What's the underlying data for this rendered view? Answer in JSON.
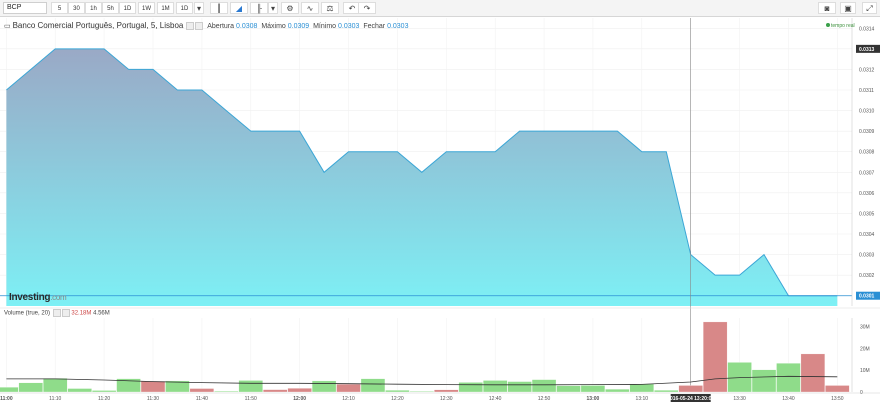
{
  "toolbar": {
    "symbol": "BCP",
    "timeframes": [
      "5",
      "30",
      "1h",
      "5h",
      "1D",
      "1W",
      "1M",
      "1D"
    ],
    "active_timeframe_index": 0,
    "tool_icons": [
      "candles-icon",
      "area-chart-icon",
      "bar-chart-icon",
      "chevron-down-icon",
      "settings-gear-icon",
      "indicators-icon",
      "compare-scale-icon",
      "undo-icon",
      "redo-icon"
    ],
    "right_icons": [
      "camera-icon",
      "layout-icon",
      "fullscreen-icon"
    ]
  },
  "legend": {
    "title": "Banco Comercial Português, Portugal, 5, Lisboa",
    "apertura_label": "Abertura",
    "apertura": "0.0308",
    "maximo_label": "Máximo",
    "maximo": "0.0309",
    "minimo_label": "Mínimo",
    "minimo": "0.0303",
    "fecho_label": "Fechar",
    "fecho": "0.0303"
  },
  "realtime_label": "tempo real",
  "watermark": {
    "brand": "Investing",
    "suffix": ".com"
  },
  "volume_legend": {
    "label": "Volume (true, 20)",
    "value_red": "32.18M",
    "value": "4.56M"
  },
  "current_price_label": "0.0313",
  "last_price_label": "0.0301",
  "crosshair_time_label": "2016-05-24 13:20:00",
  "colors": {
    "area_top": "#9aa9c6",
    "area_bottom": "#7df0f5",
    "line": "#3ba6d6",
    "bar_up": "#8fdc8a",
    "bar_down": "#d88888",
    "ma_line": "#333333",
    "last_price": "#2a8fd4"
  },
  "chart_data": [
    {
      "type": "area",
      "x_ticks": [
        "11:00",
        "11:10",
        "11:20",
        "11:30",
        "11:40",
        "11:50",
        "12:00",
        "12:10",
        "12:20",
        "12:30",
        "12:40",
        "12:50",
        "13:00",
        "13:10",
        "13:20",
        "13:30",
        "13:40",
        "13:50"
      ],
      "y_ticks": [
        "0.0314",
        "0.0313",
        "0.0312",
        "0.0311",
        "0.0310",
        "0.0309",
        "0.0308",
        "0.0307",
        "0.0306",
        "0.0305",
        "0.0304",
        "0.0303",
        "0.0302",
        "0.0301"
      ],
      "ylim": [
        0.03005,
        0.03145
      ],
      "xlim": [
        -1.3,
        173
      ],
      "x": [
        0,
        10,
        20,
        25,
        30,
        35,
        40,
        45,
        50,
        55,
        60,
        65,
        70,
        75,
        80,
        85,
        90,
        95,
        100,
        105,
        110,
        115,
        120,
        125,
        130,
        135,
        140,
        145,
        150,
        155,
        160,
        165,
        170
      ],
      "y": [
        0.0311,
        0.0313,
        0.0313,
        0.0312,
        0.0312,
        0.0311,
        0.0311,
        0.031,
        0.0309,
        0.0309,
        0.0309,
        0.0307,
        0.0308,
        0.0308,
        0.0308,
        0.0307,
        0.0308,
        0.0308,
        0.0308,
        0.0309,
        0.0309,
        0.0309,
        0.0309,
        0.0309,
        0.0308,
        0.0308,
        0.0303,
        0.0302,
        0.0302,
        0.0303,
        0.0301,
        0.0301,
        0.0301
      ]
    },
    {
      "type": "bar",
      "y_ticks": [
        "30M",
        "20M",
        "10M",
        "0"
      ],
      "ylim": [
        0,
        34
      ],
      "bar_x": [
        0,
        5,
        10,
        15,
        20,
        25,
        30,
        35,
        40,
        45,
        50,
        55,
        60,
        65,
        70,
        75,
        80,
        85,
        90,
        95,
        100,
        105,
        110,
        115,
        120,
        125,
        130,
        135,
        140,
        145,
        150,
        155,
        160,
        165,
        170
      ],
      "values": [
        2.2,
        4.2,
        6.3,
        1.6,
        0.7,
        6.1,
        5.0,
        5.1,
        1.6,
        0.4,
        5.3,
        1.1,
        1.7,
        5.1,
        3.6,
        6.1,
        0.8,
        0.3,
        1.0,
        4.4,
        5.3,
        4.8,
        5.7,
        2.9,
        3.0,
        1.3,
        3.7,
        0.8,
        3.0,
        32.2,
        13.6,
        10.2,
        13.2,
        17.5,
        3.0
      ],
      "directions": [
        "up",
        "up",
        "up",
        "up",
        "up",
        "up",
        "down",
        "up",
        "down",
        "up",
        "up",
        "down",
        "down",
        "up",
        "down",
        "up",
        "up",
        "up",
        "down",
        "up",
        "up",
        "up",
        "up",
        "up",
        "up",
        "up",
        "up",
        "up",
        "down",
        "down",
        "up",
        "up",
        "up",
        "down",
        "down"
      ],
      "ma_x": [
        0,
        10,
        20,
        30,
        40,
        50,
        60,
        70,
        80,
        90,
        100,
        110,
        120,
        130,
        140,
        145,
        150,
        160,
        170
      ],
      "ma_values": [
        6.0,
        6.0,
        5.5,
        4.8,
        4.3,
        4.0,
        4.0,
        3.8,
        3.6,
        3.4,
        3.3,
        3.3,
        3.4,
        3.5,
        4.6,
        6.0,
        6.6,
        7.2,
        7.0
      ]
    }
  ]
}
